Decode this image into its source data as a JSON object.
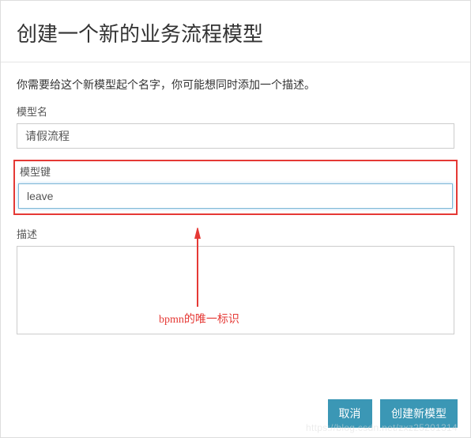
{
  "modal": {
    "title": "创建一个新的业务流程模型",
    "instruction": "你需要给这个新模型起个名字，你可能想同时添加一个描述。"
  },
  "form": {
    "name_label": "模型名",
    "name_value": "请假流程",
    "key_label": "模型键",
    "key_value": "leave",
    "desc_label": "描述",
    "desc_value": ""
  },
  "buttons": {
    "cancel": "取消",
    "create": "创建新模型"
  },
  "annotation": {
    "text": "bpmn的唯一标识",
    "arrow_color": "#e53935"
  },
  "watermark": "https://blog.csdn.net/zxz25201314"
}
